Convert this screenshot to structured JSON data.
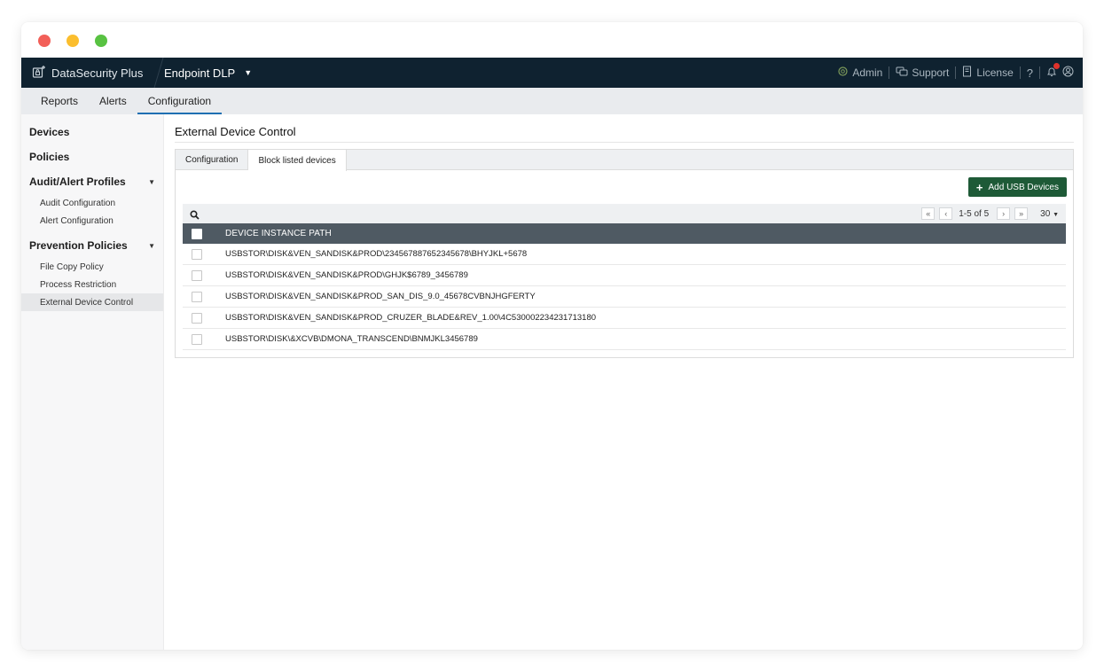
{
  "header": {
    "brand": "DataSecurity Plus",
    "product": "Endpoint DLP",
    "right_items": [
      {
        "label": "Admin",
        "icon": "admin-icon"
      },
      {
        "label": "Support",
        "icon": "support-icon"
      },
      {
        "label": "License",
        "icon": "license-icon"
      }
    ],
    "help": "?"
  },
  "nav": {
    "tabs": [
      {
        "label": "Reports"
      },
      {
        "label": "Alerts"
      },
      {
        "label": "Configuration"
      }
    ],
    "active_tab": "Configuration"
  },
  "sidebar": {
    "items": [
      {
        "label": "Devices"
      },
      {
        "label": "Policies"
      },
      {
        "label": "Audit/Alert Profiles"
      },
      {
        "label": "Prevention Policies"
      }
    ],
    "audit_sub": [
      {
        "label": "Audit Configuration"
      },
      {
        "label": "Alert Configuration"
      }
    ],
    "prevention_sub": [
      {
        "label": "File Copy Policy"
      },
      {
        "label": "Process Restriction"
      },
      {
        "label": "External Device Control"
      }
    ],
    "active_item": "External Device Control"
  },
  "main": {
    "title": "External Device Control",
    "subtabs": [
      {
        "label": "Configuration"
      },
      {
        "label": "Block listed devices"
      }
    ],
    "active_subtab": "Block listed devices",
    "add_button": "Add USB Devices",
    "pagination": {
      "info": "1-5 of 5",
      "page_size": "30"
    },
    "table": {
      "header": "DEVICE INSTANCE PATH",
      "rows": [
        {
          "path": "USBSTOR\\DISK&VEN_SANDISK&PROD\\234567887652345678\\BHYJKL+5678"
        },
        {
          "path": "USBSTOR\\DISK&VEN_SANDISK&PROD\\GHJK$6789_3456789"
        },
        {
          "path": "USBSTOR\\DISK&VEN_SANDISK&PROD_SAN_DIS_9.0_45678CVBNJHGFERTY"
        },
        {
          "path": "USBSTOR\\DISK&VEN_SANDISK&PROD_CRUZER_BLADE&REV_1.00\\4C530002234231713180"
        },
        {
          "path": "USBSTOR\\DISK\\&XCVB\\DMONA_TRANSCEND\\BNMJKL3456789"
        }
      ]
    }
  },
  "colors": {
    "topbar": "#0f2230",
    "accent_tab": "#1f6fb2",
    "add_button": "#1e5a37",
    "table_header": "#4f5a63"
  }
}
